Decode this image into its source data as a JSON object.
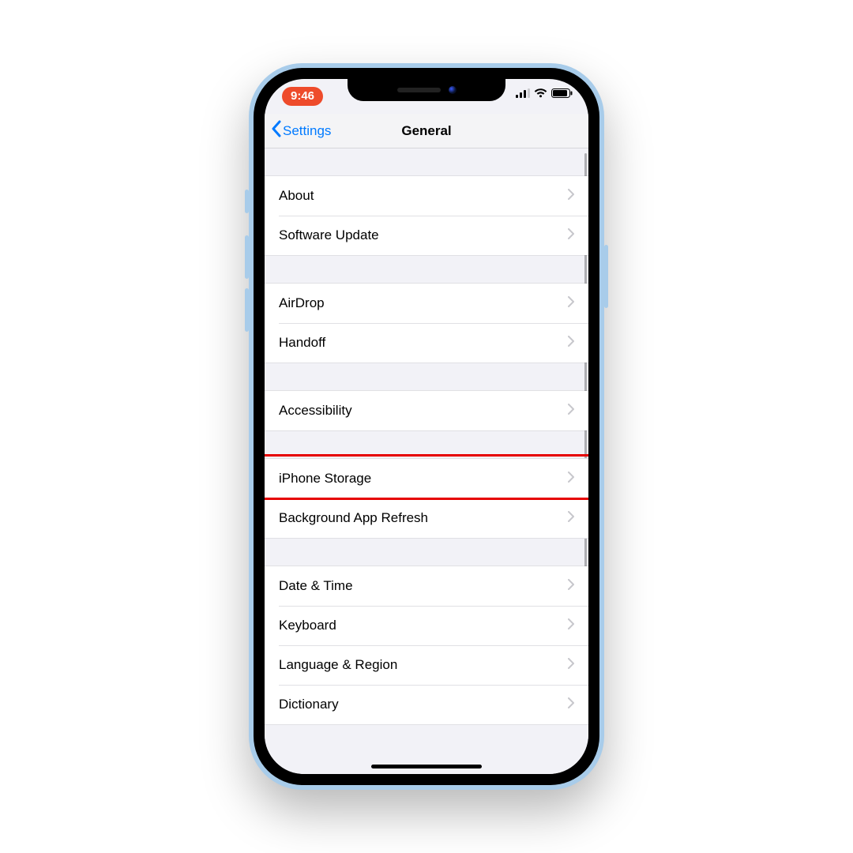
{
  "status": {
    "time": "9:46"
  },
  "nav": {
    "back_label": "Settings",
    "title": "General"
  },
  "groups": [
    {
      "rows": [
        {
          "key": "about",
          "label": "About"
        },
        {
          "key": "software-update",
          "label": "Software Update"
        }
      ]
    },
    {
      "rows": [
        {
          "key": "airdrop",
          "label": "AirDrop"
        },
        {
          "key": "handoff",
          "label": "Handoff"
        }
      ]
    },
    {
      "rows": [
        {
          "key": "accessibility",
          "label": "Accessibility"
        }
      ]
    },
    {
      "rows": [
        {
          "key": "iphone-storage",
          "label": "iPhone Storage",
          "highlight": true
        },
        {
          "key": "background-app-refresh",
          "label": "Background App Refresh"
        }
      ]
    },
    {
      "rows": [
        {
          "key": "date-time",
          "label": "Date & Time"
        },
        {
          "key": "keyboard",
          "label": "Keyboard"
        },
        {
          "key": "language-region",
          "label": "Language & Region"
        },
        {
          "key": "dictionary",
          "label": "Dictionary"
        }
      ]
    }
  ],
  "colors": {
    "accent": "#007aff",
    "time_pill": "#ee4b2b",
    "highlight": "#e60000",
    "chassis": "#a8ccea"
  }
}
